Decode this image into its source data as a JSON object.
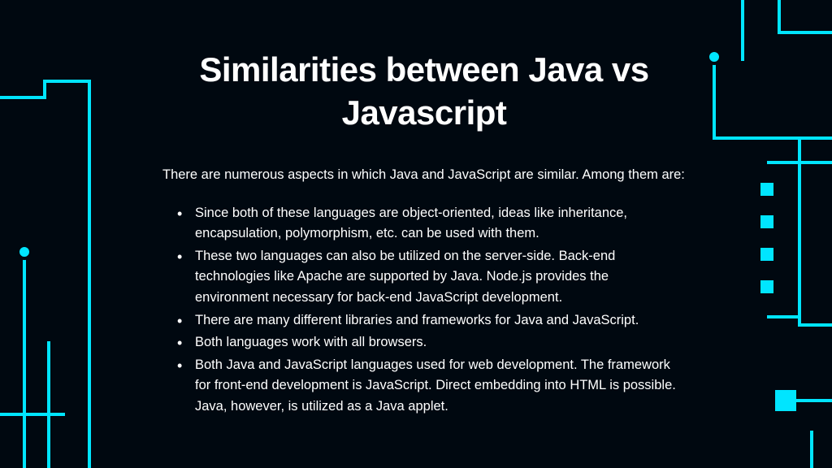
{
  "title": "Similarities between Java vs Javascript",
  "intro": "There are numerous aspects in which Java and JavaScript are similar. Among them are:",
  "bullets": [
    "Since both of these languages are object-oriented, ideas like inheritance, encapsulation, polymorphism, etc. can be used with them.",
    "These two languages can also be utilized on the server-side. Back-end technologies like Apache are supported by Java. Node.js provides the environment necessary for back-end JavaScript development.",
    "There are many different libraries and frameworks for Java and JavaScript.",
    "Both languages work with all browsers.",
    "Both Java and JavaScript languages used for web development. The framework for front-end development is JavaScript. Direct embedding into HTML is possible. Java, however, is utilized as a Java applet."
  ],
  "colors": {
    "background": "#000810",
    "accent": "#00e5ff",
    "text": "#ffffff"
  }
}
